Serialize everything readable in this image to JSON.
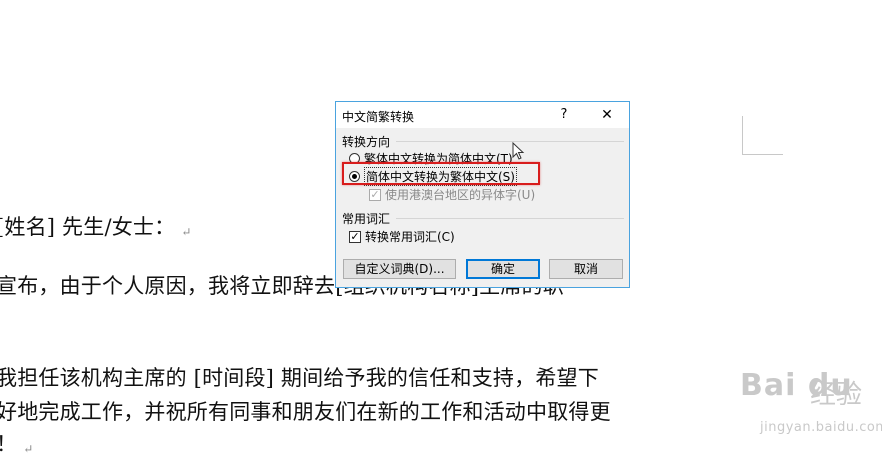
{
  "document": {
    "lines": [
      "[姓名] 先生/女士：",
      "宣布，由于个人原因，我将立即辞去[组织机构名称]主席的职",
      "我担任该机构主席的 [时间段] 期间给予我的信任和支持，希望下",
      "好地完成工作，并祝所有同事和朋友们在新的工作和活动中取得更",
      "！"
    ],
    "paragraph_mark": "↵"
  },
  "dialog": {
    "title": "中文简繁转换",
    "help_label": "?",
    "close_label": "✕",
    "direction_group": "转换方向",
    "options": {
      "trad_to_simp": "繁体中文转换为简体中文(T)",
      "simp_to_trad": "简体中文转换为繁体中文(S)",
      "use_hk_tw_variants": "使用港澳台地区的异体字(U)"
    },
    "selected_option": "simp_to_trad",
    "common_words_group": "常用词汇",
    "convert_common_words": "转换常用词汇(C)",
    "convert_common_words_checked": true,
    "custom_dict_button": "自定义词典(D)...",
    "ok_button": "确定",
    "cancel_button": "取消"
  },
  "watermark": {
    "logo": "Bai du",
    "brand": "经验",
    "url": "jingyan.baidu.com"
  },
  "colors": {
    "highlight": "#d81c1c",
    "dialog_border": "#4aa3df",
    "default_button_border": "#0078d7"
  }
}
